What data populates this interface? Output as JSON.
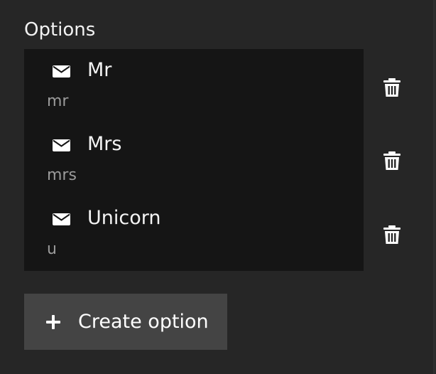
{
  "options_section": {
    "title": "Options",
    "items": [
      {
        "label": "Mr",
        "value": "mr",
        "icon": "envelope-icon",
        "delete_icon": "trash-icon"
      },
      {
        "label": "Mrs",
        "value": "mrs",
        "icon": "envelope-icon",
        "delete_icon": "trash-icon"
      },
      {
        "label": "Unicorn",
        "value": "u",
        "icon": "envelope-icon",
        "delete_icon": "trash-icon"
      }
    ]
  },
  "create_button": {
    "label": "Create option",
    "icon": "plus-icon"
  },
  "colors": {
    "panel_bg": "#262626",
    "list_bg": "#151515",
    "button_bg": "#444444",
    "text_primary": "#f4f4f4",
    "text_secondary": "#9b9b9b"
  }
}
